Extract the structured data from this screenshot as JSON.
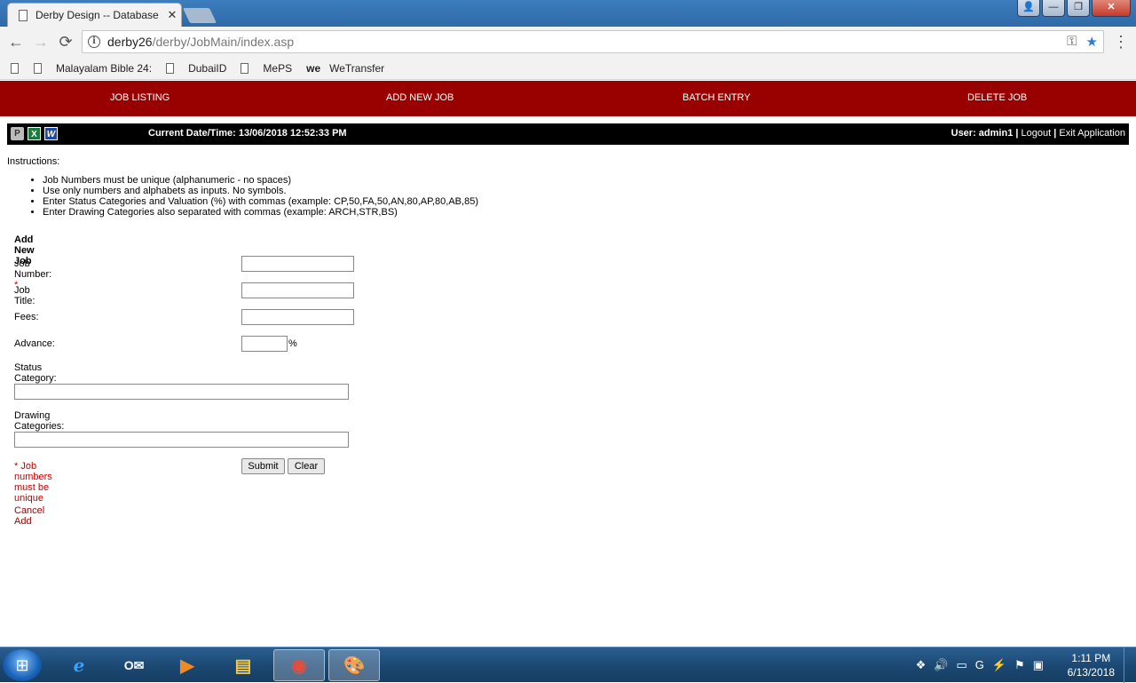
{
  "browser": {
    "tab_title": "Derby Design -- Database",
    "tab_close": "✕",
    "url_host": "derby26",
    "url_path": "/derby/JobMain/index.asp",
    "back": "←",
    "forward": "→",
    "reload": "⟳",
    "key_icon_glyph": "⚿",
    "star_icon_glyph": "★",
    "menu_glyph": "⋮",
    "window_controls": {
      "minimize": "—",
      "maximize": "❐",
      "close": "✕",
      "user": "👤"
    },
    "bookmarks": [
      {
        "label": ""
      },
      {
        "label": "Malayalam Bible 24:"
      },
      {
        "label": "DubaiID"
      },
      {
        "label": "MePS"
      },
      {
        "label": "WeTransfer",
        "prefix": "we"
      }
    ]
  },
  "nav": {
    "job_listing": "JOB LISTING",
    "add_new_job": "ADD NEW JOB",
    "batch_entry": "BATCH ENTRY",
    "delete_job": "DELETE JOB"
  },
  "infobar": {
    "datetime": "Current Date/Time: 13/06/2018 12:52:33 PM",
    "user": "User: admin1",
    "separator": "|",
    "logout": "Logout",
    "exit": "Exit Application",
    "icons": {
      "printer": "P",
      "excel": "X",
      "word": "W"
    }
  },
  "instructions": {
    "label": "Instructions:",
    "items": [
      "Job Numbers must be unique (alphanumeric - no spaces)",
      "Use only numbers and alphabets as inputs. No symbols.",
      "Enter Status Categories and Valuation (%) with commas (example: CP,50,FA,50,AN,80,AP,80,AB,85)",
      "Enter Drawing Categories also separated with commas (example: ARCH,STR,BS)"
    ]
  },
  "form": {
    "heading": "Add New Job",
    "job_number_label": "Job Number:",
    "required_mark": "*",
    "job_title_label": "Job Title:",
    "fees_label": "Fees:",
    "advance_label": "Advance:",
    "percent": "%",
    "status_category_label": "Status Category:",
    "drawing_categories_label": "Drawing Categories:",
    "job_number_value": "",
    "job_title_value": "",
    "fees_value": "",
    "advance_value": "",
    "status_category_value": "",
    "drawing_categories_value": "",
    "note": "* Job numbers must be unique",
    "submit": "Submit",
    "clear": "Clear",
    "cancel": "Cancel Add"
  },
  "taskbar": {
    "start_glyph": "⊞",
    "apps": [
      {
        "name": "ie",
        "glyph": "e"
      },
      {
        "name": "outlook",
        "glyph": "O✉"
      },
      {
        "name": "media",
        "glyph": "▶"
      },
      {
        "name": "explorer",
        "glyph": "▤"
      },
      {
        "name": "chrome",
        "glyph": "◉"
      },
      {
        "name": "paint",
        "glyph": "🎨"
      }
    ],
    "tray_glyphs": [
      "❖",
      "🔊",
      "▭",
      "G",
      "⚡",
      "⚑",
      "▣"
    ],
    "time": "1:11 PM",
    "date": "6/13/2018"
  },
  "colors": {
    "nav_bg": "#990000",
    "required": "#cc0000"
  }
}
